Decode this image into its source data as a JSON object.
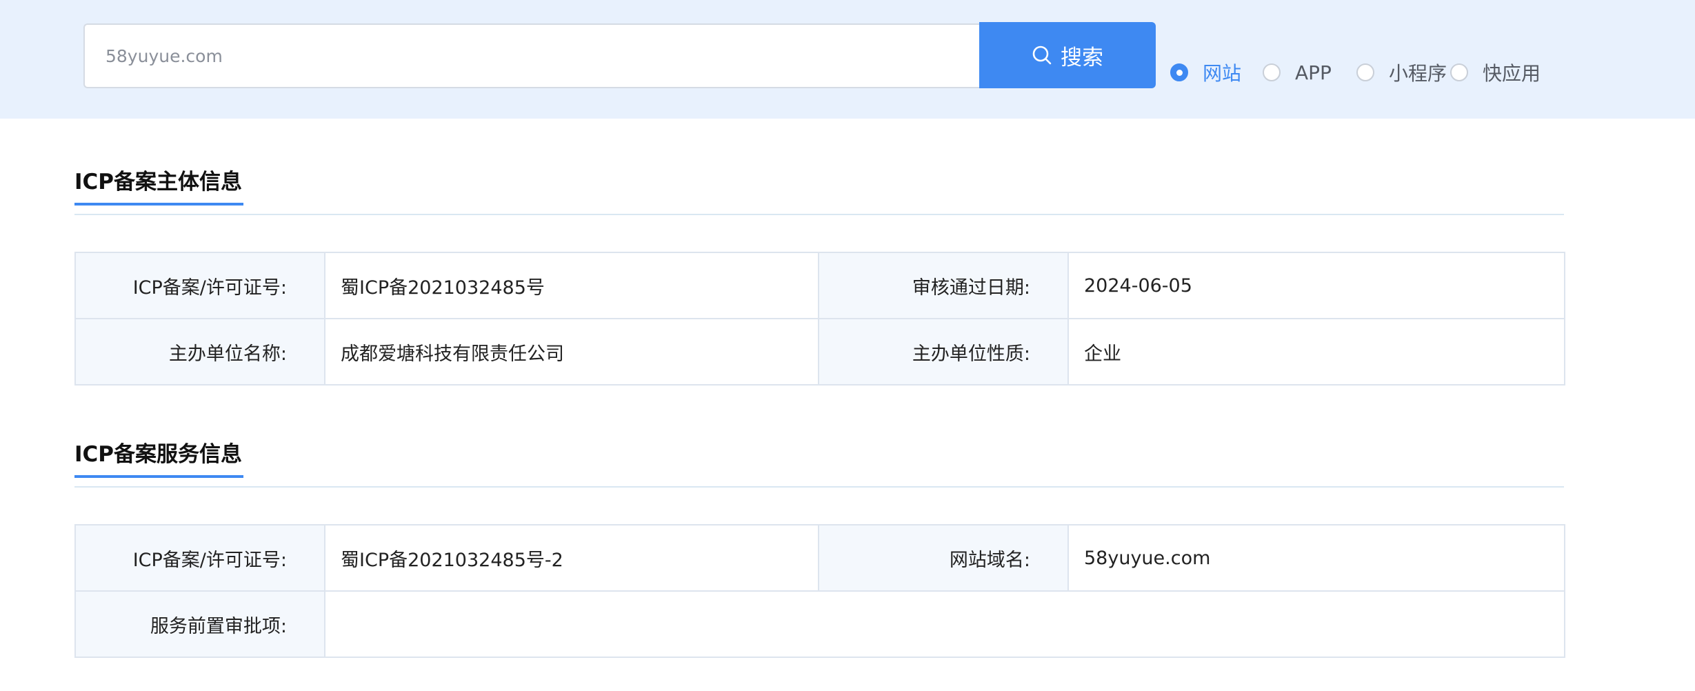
{
  "search": {
    "placeholder": "58yuyue.com",
    "button_label": "搜索"
  },
  "search_types": [
    {
      "label": "网站",
      "checked": true
    },
    {
      "label": "APP",
      "checked": false
    },
    {
      "label": "小程序",
      "checked": false
    },
    {
      "label": "快应用",
      "checked": false
    }
  ],
  "sections": {
    "subject": {
      "title": "ICP备案主体信息",
      "rows": [
        {
          "label1": "ICP备案/许可证号:",
          "value1": "蜀ICP备2021032485号",
          "label2": "审核通过日期:",
          "value2": "2024-06-05"
        },
        {
          "label1": "主办单位名称:",
          "value1": "成都爱塘科技有限责任公司",
          "label2": "主办单位性质:",
          "value2": "企业"
        }
      ]
    },
    "service": {
      "title": "ICP备案服务信息",
      "rows": [
        {
          "label1": "ICP备案/许可证号:",
          "value1": "蜀ICP备2021032485号-2",
          "label2": "网站域名:",
          "value2": "58yuyue.com"
        },
        {
          "label1": "服务前置审批项:",
          "value1": ""
        }
      ]
    }
  },
  "colors": {
    "accent": "#3e89f2",
    "top_band": "#e8f1fd",
    "label_cell_bg": "#f4f8fd",
    "border": "#dde4ee"
  }
}
